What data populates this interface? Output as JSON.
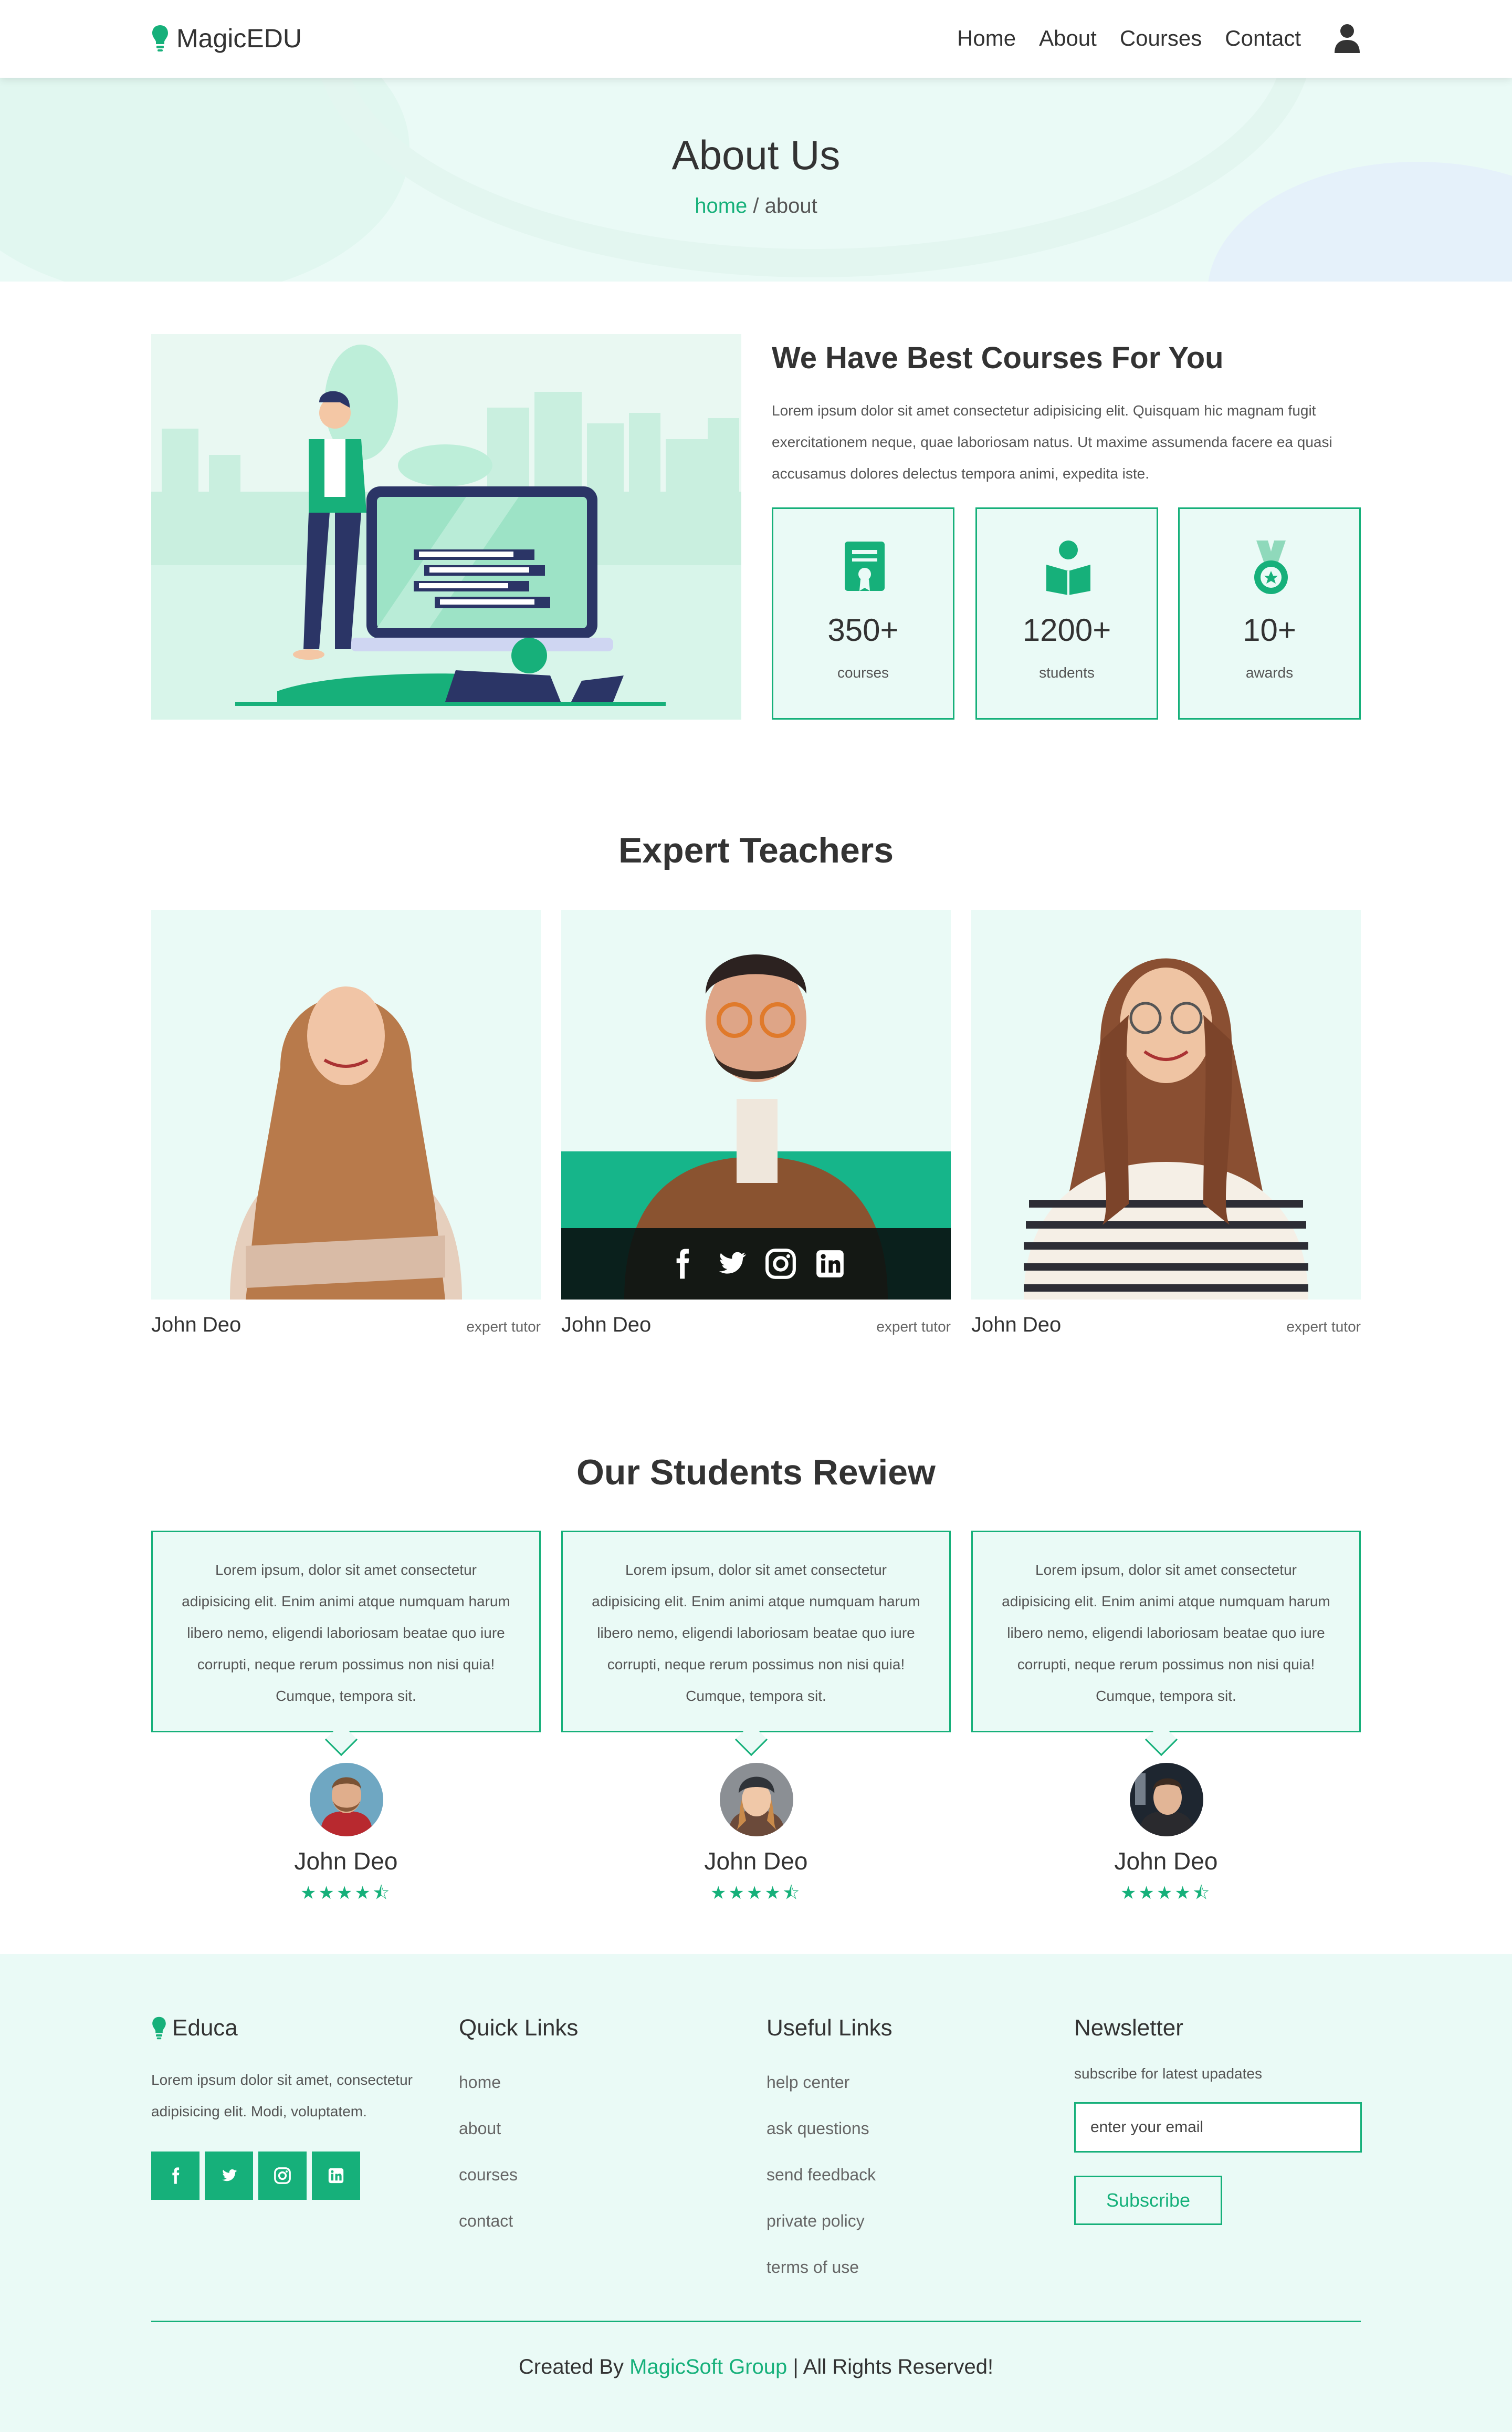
{
  "header": {
    "logo_text": "MagicEDU",
    "nav": [
      "Home",
      "About",
      "Courses",
      "Contact"
    ]
  },
  "hero": {
    "title": "About Us",
    "breadcrumb_home": "home",
    "breadcrumb_sep": " / ",
    "breadcrumb_current": "about"
  },
  "about": {
    "title": "We Have Best Courses For You",
    "description": "Lorem ipsum dolor sit amet consectetur adipisicing elit. Quisquam hic magnam fugit exercitationem neque, quae laboriosam natus. Ut maxime assumenda facere ea quasi accusamus dolores delectus tempora animi, expedita iste.",
    "stats": [
      {
        "icon": "certificate-icon",
        "number": "350+",
        "label": "courses"
      },
      {
        "icon": "student-reading-icon",
        "number": "1200+",
        "label": "students"
      },
      {
        "icon": "award-medal-icon",
        "number": "10+",
        "label": "awards"
      }
    ]
  },
  "teachers": {
    "title": "Expert Teachers",
    "items": [
      {
        "name": "John Deo",
        "role": "expert tutor"
      },
      {
        "name": "John Deo",
        "role": "expert tutor"
      },
      {
        "name": "John Deo",
        "role": "expert tutor"
      }
    ],
    "social_icons": [
      "facebook-icon",
      "twitter-icon",
      "instagram-icon",
      "linkedin-icon"
    ]
  },
  "reviews": {
    "title": "Our Students Review",
    "items": [
      {
        "text": "Lorem ipsum, dolor sit amet consectetur adipisicing elit. Enim animi atque numquam harum libero nemo, eligendi laboriosam beatae quo iure corrupti, neque rerum possimus non nisi quia! Cumque, tempora sit.",
        "name": "John Deo",
        "stars": "★★★★⯪",
        "rating": 4.5
      },
      {
        "text": "Lorem ipsum, dolor sit amet consectetur adipisicing elit. Enim animi atque numquam harum libero nemo, eligendi laboriosam beatae quo iure corrupti, neque rerum possimus non nisi quia! Cumque, tempora sit.",
        "name": "John Deo",
        "stars": "★★★★⯪",
        "rating": 4.5
      },
      {
        "text": "Lorem ipsum, dolor sit amet consectetur adipisicing elit. Enim animi atque numquam harum libero nemo, eligendi laboriosam beatae quo iure corrupti, neque rerum possimus non nisi quia! Cumque, tempora sit.",
        "name": "John Deo",
        "stars": "★★★★⯪",
        "rating": 4.5
      }
    ]
  },
  "footer": {
    "brand": "Educa",
    "description": "Lorem ipsum dolor sit amet, consectetur adipisicing elit. Modi, voluptatem.",
    "social_icons": [
      "facebook-icon",
      "twitter-icon",
      "instagram-icon",
      "linkedin-icon"
    ],
    "quick_links_title": "Quick Links",
    "quick_links": [
      "home",
      "about",
      "courses",
      "contact"
    ],
    "useful_links_title": "Useful Links",
    "useful_links": [
      "help center",
      "ask questions",
      "send feedback",
      "private policy",
      "terms of use"
    ],
    "newsletter_title": "Newsletter",
    "newsletter_sub": "subscribe for latest upadates",
    "email_placeholder": "enter your email",
    "subscribe_label": "Subscribe",
    "credit_prefix": "Created By ",
    "credit_brand": "MagicSoft Group",
    "credit_suffix": " | All Rights Reserved!"
  },
  "colors": {
    "accent": "#16b07a",
    "panel": "#eafaf6",
    "text": "#333333"
  }
}
